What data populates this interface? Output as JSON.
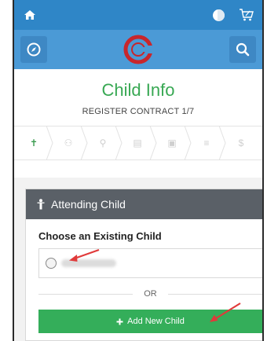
{
  "topbar": {
    "home_icon": "home-icon",
    "theme_icon": "half-moon-icon",
    "cart_icon": "cart-icon"
  },
  "header": {
    "left_icon": "compass-icon",
    "logo_icon": "brand-logo-icon",
    "right_icon": "search-icon"
  },
  "page": {
    "title": "Child Info",
    "subtitle": "REGISTER CONTRACT 1/7"
  },
  "steps": [
    {
      "icon": "child-icon",
      "glyph": "✝",
      "active": true
    },
    {
      "icon": "users-icon",
      "glyph": "⚇",
      "active": false
    },
    {
      "icon": "location-icon",
      "glyph": "⚲",
      "active": false
    },
    {
      "icon": "building-icon",
      "glyph": "▤",
      "active": false
    },
    {
      "icon": "calendar-icon",
      "glyph": "▣",
      "active": false
    },
    {
      "icon": "list-icon",
      "glyph": "≡",
      "active": false
    },
    {
      "icon": "dollar-icon",
      "glyph": "$",
      "active": false
    }
  ],
  "panel": {
    "heading": "Attending Child",
    "choose_label": "Choose an Existing Child",
    "or_text": "OR",
    "add_button": "Add New Child",
    "add_icon": "plus-icon"
  },
  "colors": {
    "topbar": "#2f86c7",
    "header": "#4b9ad6",
    "title": "#38a853",
    "button": "#34ae5a",
    "panel_head": "#5a6067",
    "arrow": "#e03a3a"
  }
}
